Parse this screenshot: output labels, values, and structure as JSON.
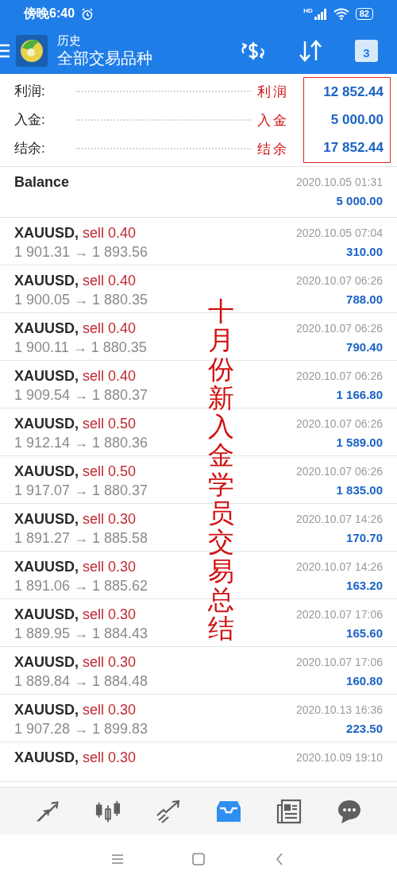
{
  "status_bar": {
    "time": "傍晚6:40",
    "network_label": "HD",
    "battery": "82"
  },
  "header": {
    "subtitle": "历史",
    "title": "全部交易品种",
    "calendar_day": "3"
  },
  "summary": [
    {
      "label": "利润:",
      "annotation": "利润",
      "value": "12 852.44"
    },
    {
      "label": "入金:",
      "annotation": "入金",
      "value": "5 000.00"
    },
    {
      "label": "结余:",
      "annotation": "结余",
      "value": "17 852.44"
    }
  ],
  "vertical_annotation": "十月份新入金学员交易总结",
  "records": [
    {
      "kind": "balance",
      "title": "Balance",
      "time": "2020.10.05 01:31",
      "amount": "5 000.00"
    },
    {
      "kind": "trade",
      "symbol": "XAUUSD,",
      "side": "sell 0.40",
      "prices": "1 901.31 → 1 893.56",
      "time": "2020.10.05 07:04",
      "amount": "310.00"
    },
    {
      "kind": "trade",
      "symbol": "XAUUSD,",
      "side": "sell 0.40",
      "prices": "1 900.05 → 1 880.35",
      "time": "2020.10.07 06:26",
      "amount": "788.00"
    },
    {
      "kind": "trade",
      "symbol": "XAUUSD,",
      "side": "sell 0.40",
      "prices": "1 900.11 → 1 880.35",
      "time": "2020.10.07 06:26",
      "amount": "790.40"
    },
    {
      "kind": "trade",
      "symbol": "XAUUSD,",
      "side": "sell 0.40",
      "prices": "1 909.54 → 1 880.37",
      "time": "2020.10.07 06:26",
      "amount": "1 166.80"
    },
    {
      "kind": "trade",
      "symbol": "XAUUSD,",
      "side": "sell 0.50",
      "prices": "1 912.14 → 1 880.36",
      "time": "2020.10.07 06:26",
      "amount": "1 589.00"
    },
    {
      "kind": "trade",
      "symbol": "XAUUSD,",
      "side": "sell 0.50",
      "prices": "1 917.07 → 1 880.37",
      "time": "2020.10.07 06:26",
      "amount": "1 835.00"
    },
    {
      "kind": "trade",
      "symbol": "XAUUSD,",
      "side": "sell 0.30",
      "prices": "1 891.27 → 1 885.58",
      "time": "2020.10.07 14:26",
      "amount": "170.70"
    },
    {
      "kind": "trade",
      "symbol": "XAUUSD,",
      "side": "sell 0.30",
      "prices": "1 891.06 → 1 885.62",
      "time": "2020.10.07 14:26",
      "amount": "163.20"
    },
    {
      "kind": "trade",
      "symbol": "XAUUSD,",
      "side": "sell 0.30",
      "prices": "1 889.95 → 1 884.43",
      "time": "2020.10.07 17:06",
      "amount": "165.60"
    },
    {
      "kind": "trade",
      "symbol": "XAUUSD,",
      "side": "sell 0.30",
      "prices": "1 889.84 → 1 884.48",
      "time": "2020.10.07 17:06",
      "amount": "160.80"
    },
    {
      "kind": "trade",
      "symbol": "XAUUSD,",
      "side": "sell 0.30",
      "prices": "1 907.28 → 1 899.83",
      "time": "2020.10.13 16:36",
      "amount": "223.50"
    },
    {
      "kind": "trade_partial",
      "symbol": "XAUUSD,",
      "side": "sell 0.30",
      "time": "2020.10.09 19:10"
    }
  ],
  "bottom_tabs": [
    {
      "kind": "quotes",
      "selected": false
    },
    {
      "kind": "charts",
      "selected": false
    },
    {
      "kind": "trade",
      "selected": false
    },
    {
      "kind": "history",
      "selected": true
    },
    {
      "kind": "news",
      "selected": false
    },
    {
      "kind": "chat",
      "selected": false
    }
  ]
}
